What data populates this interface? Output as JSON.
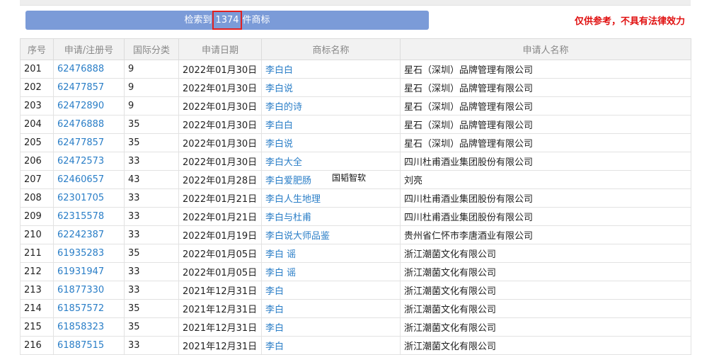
{
  "search": {
    "prefix": "检索到",
    "count": "1374",
    "suffix": "件商标"
  },
  "disclaimer": "仅供参考，不具有法律效力",
  "watermark": "国韬智软",
  "table": {
    "headers": [
      "序号",
      "申请/注册号",
      "国际分类",
      "申请日期",
      "商标名称",
      "申请人名称"
    ],
    "rows": [
      [
        "201",
        "62476888",
        "9",
        "2022年01月30日",
        "李白白",
        "星石（深圳）品牌管理有限公司"
      ],
      [
        "202",
        "62477857",
        "9",
        "2022年01月30日",
        "李白说",
        "星石（深圳）品牌管理有限公司"
      ],
      [
        "203",
        "62472890",
        "9",
        "2022年01月30日",
        "李白的诗",
        "星石（深圳）品牌管理有限公司"
      ],
      [
        "204",
        "62476888",
        "35",
        "2022年01月30日",
        "李白白",
        "星石（深圳）品牌管理有限公司"
      ],
      [
        "205",
        "62477857",
        "35",
        "2022年01月30日",
        "李白说",
        "星石（深圳）品牌管理有限公司"
      ],
      [
        "206",
        "62472573",
        "33",
        "2022年01月30日",
        "李白大全",
        "四川杜甫酒业集团股份有限公司"
      ],
      [
        "207",
        "62460657",
        "43",
        "2022年01月28日",
        "李白爱肥肠",
        "刘亮"
      ],
      [
        "208",
        "62301705",
        "33",
        "2022年01月21日",
        "李白人生地理",
        "四川杜甫酒业集团股份有限公司"
      ],
      [
        "209",
        "62315578",
        "33",
        "2022年01月21日",
        "李白与杜甫",
        "四川杜甫酒业集团股份有限公司"
      ],
      [
        "210",
        "62242387",
        "33",
        "2022年01月19日",
        "李白说大师品鉴",
        "贵州省仁怀市李唐酒业有限公司"
      ],
      [
        "211",
        "61935283",
        "35",
        "2022年01月05日",
        "李白 谣",
        "浙江潮菌文化有限公司"
      ],
      [
        "212",
        "61931947",
        "33",
        "2022年01月05日",
        "李白 谣",
        "浙江潮菌文化有限公司"
      ],
      [
        "213",
        "61877330",
        "33",
        "2021年12月31日",
        "李白",
        "浙江潮菌文化有限公司"
      ],
      [
        "214",
        "61857572",
        "35",
        "2021年12月31日",
        "李白",
        "浙江潮菌文化有限公司"
      ],
      [
        "215",
        "61858323",
        "35",
        "2021年12月31日",
        "李白",
        "浙江潮菌文化有限公司"
      ],
      [
        "216",
        "61887515",
        "33",
        "2021年12月31日",
        "李白",
        "浙江潮菌文化有限公司"
      ]
    ]
  }
}
